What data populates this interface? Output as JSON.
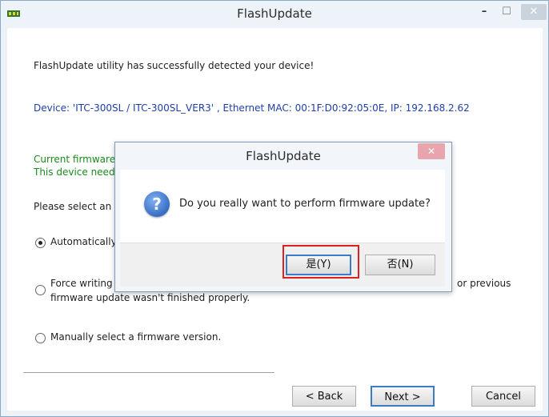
{
  "window": {
    "title": "FlashUpdate",
    "min_glyph": "–",
    "max_glyph": "☐",
    "close_glyph": "✕"
  },
  "main": {
    "success_text": "FlashUpdate utility has successfully detected your device!",
    "device_text": "Device: 'ITC-300SL / ITC-300SL_VER3' , Ethernet MAC: 00:1F:D0:92:05:0E, IP: 192.168.2.62",
    "current_firmware_text": "Current firmware",
    "device_needs_text": "This device need",
    "select_text": "Please select an",
    "options": {
      "auto_label": "Automatically",
      "force_label_line1": "Force writing",
      "force_label_suffix": "or previous",
      "force_label_line2": "firmware update wasn't finished properly.",
      "manual_label": "Manually select a firmware version."
    }
  },
  "buttons": {
    "back": "< Back",
    "next": "Next >",
    "cancel": "Cancel"
  },
  "modal": {
    "title": "FlashUpdate",
    "close_glyph": "✕",
    "icon_glyph": "?",
    "question": "Do you really want to perform firmware update?",
    "yes_label": "是(Y)",
    "no_label": "否(N)"
  },
  "colors": {
    "device_text": "#1f3fa8",
    "firmware_text": "#1b8a1b",
    "highlight": "#e02020"
  }
}
